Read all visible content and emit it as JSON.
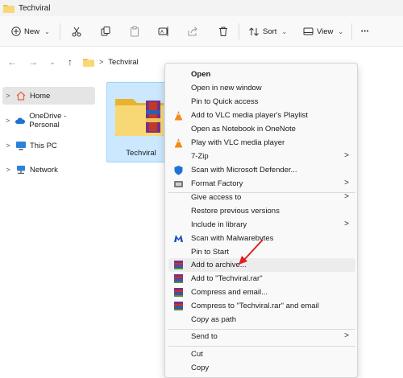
{
  "window": {
    "title": "Techviral"
  },
  "toolbar": {
    "new_label": "New",
    "sort_label": "Sort",
    "view_label": "View",
    "more_label": "•••"
  },
  "address": {
    "crumb": "Techviral"
  },
  "sidebar": {
    "items": [
      {
        "label": "Home"
      },
      {
        "label": "OneDrive - Personal"
      },
      {
        "label": "This PC"
      },
      {
        "label": "Network"
      }
    ]
  },
  "content": {
    "folder_name": "Techviral"
  },
  "context_menu": {
    "items": [
      {
        "label": "Open"
      },
      {
        "label": "Open in new window"
      },
      {
        "label": "Pin to Quick access"
      },
      {
        "label": "Add to VLC media player's Playlist"
      },
      {
        "label": "Open as Notebook in OneNote"
      },
      {
        "label": "Play with VLC media player"
      },
      {
        "label": "7-Zip"
      },
      {
        "label": "Scan with Microsoft Defender..."
      },
      {
        "label": "Format Factory"
      },
      {
        "label": "Give access to"
      },
      {
        "label": "Restore previous versions"
      },
      {
        "label": "Include in library"
      },
      {
        "label": "Scan with Malwarebytes"
      },
      {
        "label": "Pin to Start"
      },
      {
        "label": "Add to archive..."
      },
      {
        "label": "Add to \"Techviral.rar\""
      },
      {
        "label": "Compress and email..."
      },
      {
        "label": "Compress to \"Techviral.rar\" and email"
      },
      {
        "label": "Copy as path"
      },
      {
        "label": "Send to"
      },
      {
        "label": "Cut"
      },
      {
        "label": "Copy"
      }
    ]
  },
  "colors": {
    "selection": "#cce8ff",
    "accent": "#0067c0",
    "folder": "#f8d775",
    "annotation_arrow": "#e02020"
  }
}
